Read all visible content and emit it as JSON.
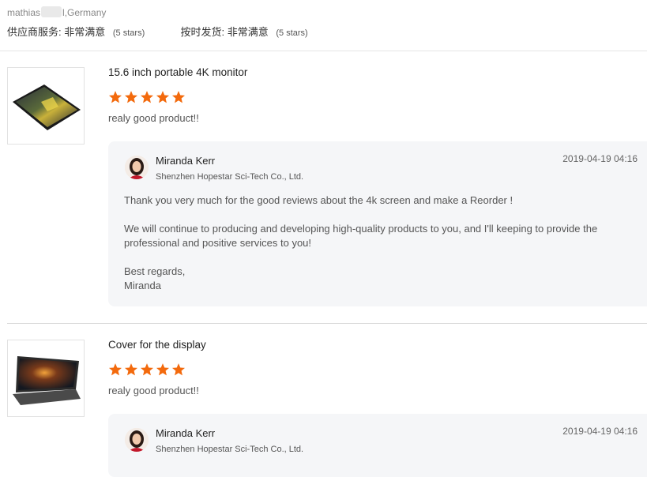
{
  "header": {
    "reviewer_name_start": "mathias",
    "reviewer_name_end": "l,Germany",
    "service_label": "供应商服务:",
    "service_value": "非常满意",
    "service_stars": "(5 stars)",
    "shipping_label": "按时发货:",
    "shipping_value": "非常满意",
    "shipping_stars": "(5 stars)"
  },
  "colors": {
    "star": "#f36a0d",
    "reply_bg": "#f5f6f8"
  },
  "reviews": [
    {
      "product_title": "15.6 inch portable 4K monitor",
      "rating": 5,
      "comment": "realy good product!!",
      "thumb_icon": "monitor-product-image",
      "reply": {
        "seller_name": "Miranda Kerr",
        "company": "Shenzhen Hopestar Sci-Tech Co., Ltd.",
        "date": "2019-04-19 04:16",
        "paragraphs": [
          "Thank you very much for the good reviews about the 4k screen and make a Reorder !",
          "We will continue to producing and developing high-quality products to you, and I'll keeping to provide the professional and positive services to you!",
          "Best regards,",
          "Miranda"
        ]
      }
    },
    {
      "product_title": "Cover for the display",
      "rating": 5,
      "comment": "realy good product!!",
      "thumb_icon": "cover-product-image",
      "reply": {
        "seller_name": "Miranda Kerr",
        "company": "Shenzhen Hopestar Sci-Tech Co., Ltd.",
        "date": "2019-04-19 04:16"
      }
    }
  ]
}
